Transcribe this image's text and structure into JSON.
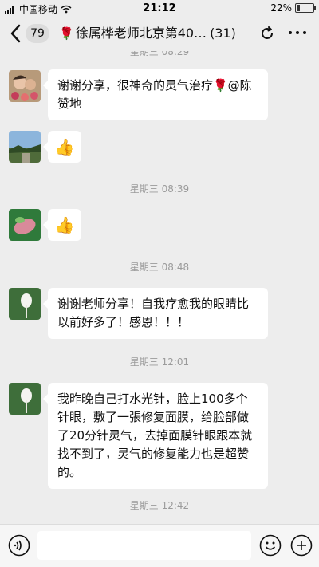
{
  "status_bar": {
    "carrier": "中国移动",
    "time": "21:12",
    "battery": "22%",
    "battery_level": 0.22
  },
  "header": {
    "back_count": "79",
    "title_rose": "🌹",
    "title": "徐属桦老师北京第40…",
    "member_count": "(31)"
  },
  "chat": {
    "top_partial_time": "星期三 08:29",
    "messages": [
      {
        "text": "谢谢分享，很神奇的灵气治疗🌹@陈赞地"
      },
      {
        "text": "👍"
      },
      {
        "time": "星期三 08:39"
      },
      {
        "text": "👍"
      },
      {
        "time": "星期三 08:48"
      },
      {
        "text": "谢谢老师分享！自我疗愈我的眼睛比以前好多了！感恩！！！"
      },
      {
        "time": "星期三 12:01"
      },
      {
        "text": "我昨晚自己打水光针，脸上100多个针眼，敷了一張修复面膜，给脸部做了20分针灵气，去掉面膜针眼跟本就找不到了，灵气的修复能力也是超赞的。"
      },
      {
        "time": "星期三 12:42"
      }
    ]
  },
  "colors": {
    "background": "#ededed",
    "bubble": "#ffffff",
    "timestamp": "#9b9b9b"
  }
}
